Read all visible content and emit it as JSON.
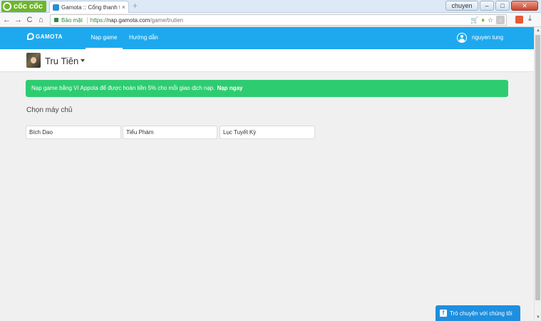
{
  "browser": {
    "brand": "cốc cốc",
    "tab_title": "Gamota :: Cổng thanh toán",
    "tab_close": "×",
    "new_tab": "+",
    "window_user_label": "chuyen",
    "address": {
      "security_label": "Bảo mật",
      "url_scheme": "https://",
      "url_host": "nap.gamota.com",
      "url_path": "/game/trutien"
    },
    "nav_icons": {
      "back": "←",
      "forward": "→",
      "reload": "C",
      "home": "⌂"
    }
  },
  "site": {
    "logo_text": "GAMOTA",
    "nav": {
      "nap_game": "Nạp game",
      "huong_dan": "Hướng dẫn"
    },
    "user": {
      "name": "nguyen tung"
    }
  },
  "game": {
    "title": "Tru Tiên"
  },
  "promo": {
    "text": "Nạp game bằng Ví Appota để được hoàn tiền 5% cho mỗi giao dịch nạp.",
    "link_label": "Nạp ngay",
    "color": "#2ecc71"
  },
  "servers": {
    "section_title": "Chọn máy chủ",
    "items": [
      "Bích Dao",
      "Tiểu Phàm",
      "Lục Tuyết Kỳ"
    ]
  },
  "chat": {
    "icon": "f",
    "label": "Trò chuyện với chúng tôi"
  },
  "colors": {
    "nav_blue": "#1ea9ee",
    "chat_blue": "#1e8fe0"
  }
}
